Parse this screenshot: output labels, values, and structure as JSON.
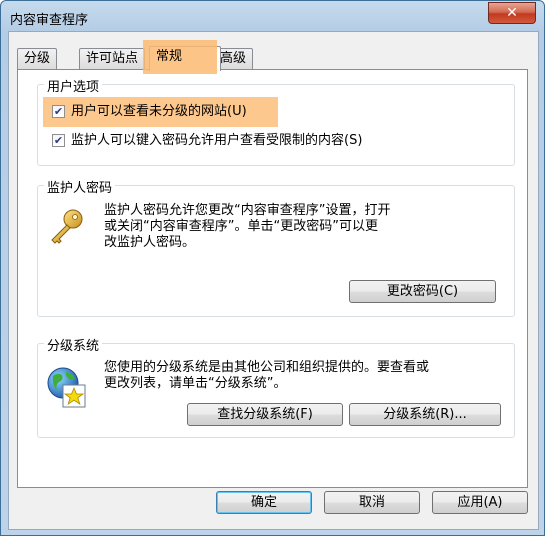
{
  "window": {
    "title": "内容审查程序",
    "close_glyph": "✕"
  },
  "tabs": [
    {
      "label": "分级",
      "active": false
    },
    {
      "label": "许可站点",
      "active": false
    },
    {
      "label": "常规",
      "active": true
    },
    {
      "label": "高级",
      "active": false
    }
  ],
  "user_options": {
    "title": "用户选项",
    "opt1": {
      "label": "用户可以查看未分级的网站(U)",
      "checked": true
    },
    "opt2": {
      "label": "监护人可以键入密码允许用户查看受限制的内容(S)",
      "checked": true
    }
  },
  "supervisor": {
    "title": "监护人密码",
    "line1": "监护人密码允许您更改“内容审查程序”设置，打开",
    "line2": "或关闭“内容审查程序”。单击“更改密码”可以更",
    "line3": "改监护人密码。",
    "change_password": "更改密码(C)",
    "icon": "key-icon"
  },
  "rating_systems": {
    "title": "分级系统",
    "line1": "您使用的分级系统是由其他公司和组织提供的。要查看或",
    "line2": "更改列表，请单击“分级系统”。",
    "find_button": "查找分级系统(F)",
    "systems_button": "分级系统(R)...",
    "icon": "globe-certificate-icon"
  },
  "footer": {
    "ok": "确定",
    "cancel": "取消",
    "apply": "应用(A)"
  },
  "colors": {
    "highlight": "#fcba71",
    "accent": "#3c7fb1"
  }
}
